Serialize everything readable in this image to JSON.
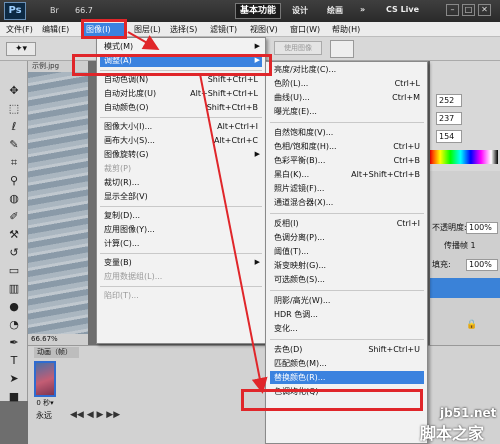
{
  "titlebar": {
    "logo": "Ps",
    "zoom": "66.7",
    "workspace_active": "基本功能",
    "workspace_design": "设计",
    "workspace_paint": "绘画",
    "more": "»",
    "cslive": "CS Live"
  },
  "menubar": [
    "文件(F)",
    "编辑(E)",
    "图像(I)",
    "图层(L)",
    "选择(S)",
    "滤镜(T)",
    "视图(V)",
    "窗口(W)",
    "帮助(H)"
  ],
  "optbar": {
    "frontimage": "使用图像"
  },
  "document": {
    "tab": "示例.jpg",
    "zoom": "66.67%"
  },
  "image_menu": {
    "items": [
      {
        "label": "模式(M)",
        "shortcut": "",
        "arrow": "▶",
        "disabled": false
      },
      {
        "label": "调整(A)",
        "shortcut": "",
        "arrow": "▶",
        "disabled": false,
        "highlighted": true
      },
      {
        "sep": true
      },
      {
        "label": "自动色调(N)",
        "shortcut": "Shift+Ctrl+L"
      },
      {
        "label": "自动对比度(U)",
        "shortcut": "Alt+Shift+Ctrl+L"
      },
      {
        "label": "自动颜色(O)",
        "shortcut": "Shift+Ctrl+B"
      },
      {
        "sep": true
      },
      {
        "label": "图像大小(I)...",
        "shortcut": "Alt+Ctrl+I"
      },
      {
        "label": "画布大小(S)...",
        "shortcut": "Alt+Ctrl+C"
      },
      {
        "label": "图像旋转(G)",
        "shortcut": "",
        "arrow": "▶"
      },
      {
        "label": "裁剪(P)",
        "shortcut": "",
        "disabled": true
      },
      {
        "label": "裁切(R)...",
        "shortcut": ""
      },
      {
        "label": "显示全部(V)",
        "shortcut": ""
      },
      {
        "sep": true
      },
      {
        "label": "复制(D)...",
        "shortcut": ""
      },
      {
        "label": "应用图像(Y)...",
        "shortcut": ""
      },
      {
        "label": "计算(C)...",
        "shortcut": ""
      },
      {
        "sep": true
      },
      {
        "label": "变量(B)",
        "shortcut": "",
        "arrow": "▶"
      },
      {
        "label": "应用数据组(L)...",
        "shortcut": "",
        "disabled": true
      },
      {
        "sep": true
      },
      {
        "label": "陷印(T)...",
        "shortcut": "",
        "disabled": true
      }
    ]
  },
  "adjust_menu": {
    "items": [
      {
        "label": "亮度/对比度(C)...",
        "shortcut": ""
      },
      {
        "label": "色阶(L)...",
        "shortcut": "Ctrl+L"
      },
      {
        "label": "曲线(U)...",
        "shortcut": "Ctrl+M"
      },
      {
        "label": "曝光度(E)...",
        "shortcut": ""
      },
      {
        "sep": true
      },
      {
        "label": "自然饱和度(V)...",
        "shortcut": ""
      },
      {
        "label": "色相/饱和度(H)...",
        "shortcut": "Ctrl+U"
      },
      {
        "label": "色彩平衡(B)...",
        "shortcut": "Ctrl+B"
      },
      {
        "label": "黑白(K)...",
        "shortcut": "Alt+Shift+Ctrl+B"
      },
      {
        "label": "照片滤镜(F)...",
        "shortcut": ""
      },
      {
        "label": "通道混合器(X)...",
        "shortcut": ""
      },
      {
        "sep": true
      },
      {
        "label": "反相(I)",
        "shortcut": "Ctrl+I"
      },
      {
        "label": "色调分离(P)...",
        "shortcut": ""
      },
      {
        "label": "阈值(T)...",
        "shortcut": ""
      },
      {
        "label": "渐变映射(G)...",
        "shortcut": ""
      },
      {
        "label": "可选颜色(S)...",
        "shortcut": ""
      },
      {
        "sep": true
      },
      {
        "label": "阴影/高光(W)...",
        "shortcut": ""
      },
      {
        "label": "HDR 色调...",
        "shortcut": ""
      },
      {
        "label": "变化...",
        "shortcut": ""
      },
      {
        "sep": true
      },
      {
        "label": "去色(D)",
        "shortcut": "Shift+Ctrl+U"
      },
      {
        "label": "匹配颜色(M)...",
        "shortcut": ""
      },
      {
        "label": "替换颜色(R)...",
        "shortcut": "",
        "highlighted": true
      },
      {
        "label": "色调均化(Q)",
        "shortcut": ""
      }
    ]
  },
  "right_panel": {
    "color_values": [
      "252",
      "237",
      "154"
    ],
    "opacity_label": "不透明度:",
    "opacity_value": "100%",
    "propagate_label": "传播帧 1",
    "fill_label": "填充:",
    "fill_value": "100%"
  },
  "animation": {
    "tab": "动画（帧）",
    "frame_time": "0 秒▾",
    "loop": "永远"
  },
  "watermark": {
    "line1": "jb51.net",
    "line2": "脚本之家"
  },
  "colors": {
    "highlight": "#3b82df",
    "red_box": "#e0262a"
  }
}
